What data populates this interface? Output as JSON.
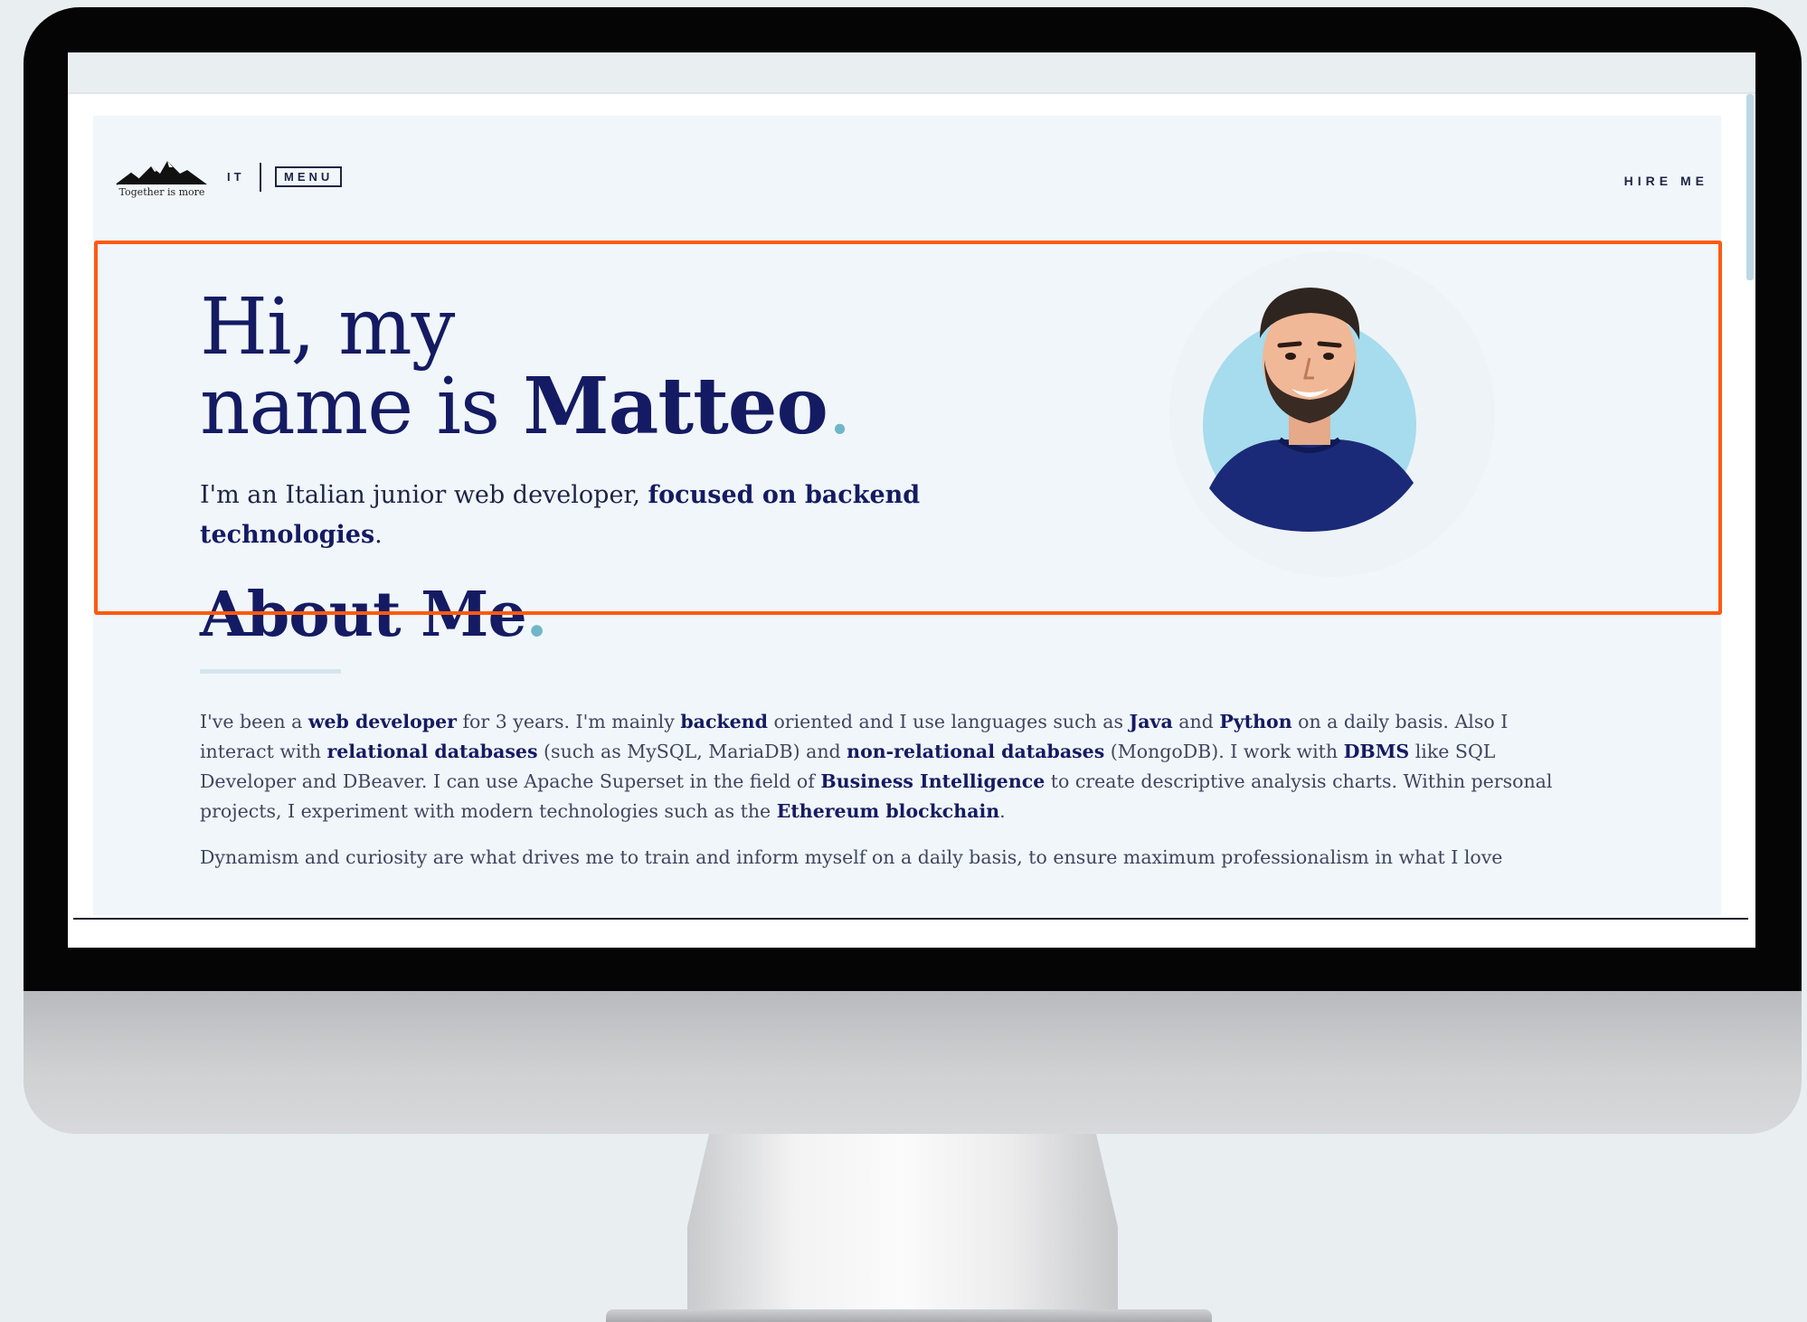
{
  "nav": {
    "logo_text": "Together is more",
    "language": "IT",
    "menu_label": "MENU",
    "hire_label": "HIRE ME"
  },
  "hero": {
    "title_line1": "Hi, my",
    "title_prefix": "name is ",
    "title_name": "Matteo",
    "title_dot": ".",
    "subtitle_plain": "I'm an Italian junior web developer, ",
    "subtitle_bold": "focused on backend technologies",
    "subtitle_end": "."
  },
  "about": {
    "title": "About Me",
    "title_dot": ".",
    "p1": [
      "I've been a ",
      "web developer",
      " for 3 years. I'm mainly ",
      "backend",
      " oriented and I use languages such as ",
      "Java",
      " and ",
      "Python",
      " on a daily basis. Also I interact with ",
      "relational databases",
      " (such as MySQL, MariaDB) and ",
      "non-relational databases",
      " (MongoDB). I work with ",
      "DBMS",
      " like SQL Developer and DBeaver. I can use Apache Superset in the field of ",
      "Business Intelligence",
      " to create descriptive analysis charts. Within personal projects, I experiment with modern technologies such as the ",
      "Ethereum blockchain",
      "."
    ],
    "p2": "Dynamism and curiosity are what drives me to train and inform myself on a daily basis, to ensure maximum professionalism in what I love"
  },
  "colors": {
    "navy": "#141b63",
    "accent_teal": "#6fb7c8",
    "highlight_orange": "#ff5a10",
    "page_bg": "#f1f6fa"
  },
  "icons": {
    "logo": "mountain-logo-icon",
    "avatar": "avatar-illustration"
  }
}
